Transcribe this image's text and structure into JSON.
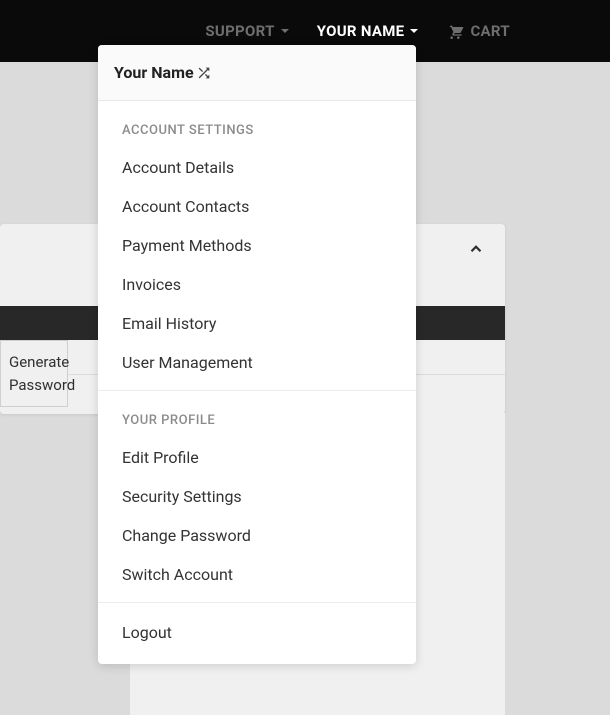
{
  "topbar": {
    "support": "SUPPORT",
    "your_name": "YOUR NAME",
    "cart": "CART"
  },
  "dropdown": {
    "header": "Your Name",
    "section1_label": "ACCOUNT SETTINGS",
    "section1_items": {
      "account_details": "Account Details",
      "account_contacts": "Account Contacts",
      "payment_methods": "Payment Methods",
      "invoices": "Invoices",
      "email_history": "Email History",
      "user_management": "User Management"
    },
    "section2_label": "YOUR PROFILE",
    "section2_items": {
      "edit_profile": "Edit Profile",
      "security_settings": "Security Settings",
      "change_password": "Change Password",
      "switch_account": "Switch Account"
    },
    "logout": "Logout"
  },
  "side_button": {
    "line1": "Generate",
    "line2": "Password"
  }
}
